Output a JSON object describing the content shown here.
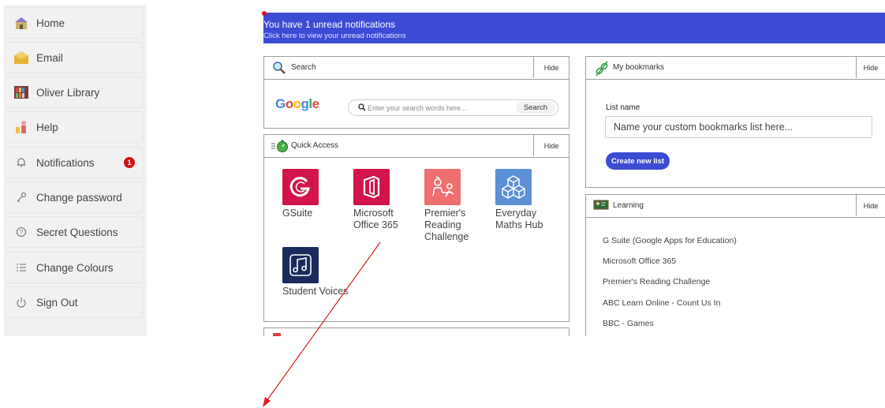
{
  "sidebar": {
    "items": [
      {
        "label": "Home",
        "icon": "home-icon"
      },
      {
        "label": "Email",
        "icon": "email-icon"
      },
      {
        "label": "Oliver Library",
        "icon": "library-icon"
      },
      {
        "label": "Help",
        "icon": "help-icon"
      },
      {
        "label": "Notifications",
        "icon": "bell-icon",
        "badge": "1"
      },
      {
        "label": "Change password",
        "icon": "key-icon"
      },
      {
        "label": "Secret Questions",
        "icon": "question-icon"
      },
      {
        "label": "Change Colours",
        "icon": "list-icon"
      },
      {
        "label": "Sign Out",
        "icon": "power-icon"
      }
    ]
  },
  "banner": {
    "title": "You have 1 unread notifications",
    "subtitle": "Click here to view your unread notifications",
    "color": "#3c4bd3"
  },
  "search_panel": {
    "title": "Search",
    "hide_label": "Hide",
    "logo_text": "Google",
    "placeholder": "Enter your search words here...",
    "button_label": "Search"
  },
  "quick_access": {
    "title": "Quick Access",
    "hide_label": "Hide",
    "tiles": [
      {
        "line1": "GSuite",
        "line2": "",
        "line3": "",
        "color": "#d2144a"
      },
      {
        "line1": "Microsoft",
        "line2": "Office 365",
        "line3": "",
        "color": "#d2144a"
      },
      {
        "line1": "Premier's",
        "line2": "Reading",
        "line3": "Challenge",
        "color": "#ee6f6f"
      },
      {
        "line1": "Everyday",
        "line2": "Maths Hub",
        "line3": "",
        "color": "#5b8fd6"
      },
      {
        "line1": "Student Voices",
        "line2": "",
        "line3": "",
        "color": "#1a2a5c"
      }
    ]
  },
  "bookmarks": {
    "title": "My bookmarks",
    "hide_label": "Hide",
    "list_name_label": "List name",
    "input_placeholder": "Name your custom bookmarks list here...",
    "create_button": "Create new list"
  },
  "learning": {
    "title": "Learning",
    "hide_label": "Hide",
    "items": [
      "G Suite (Google Apps for Education)",
      "Microsoft Office 365",
      "Premier's Reading Challenge",
      "ABC Learn Online - Count Us In",
      "BBC - Games"
    ]
  },
  "annotation_arrow_color": "#e31b1b"
}
